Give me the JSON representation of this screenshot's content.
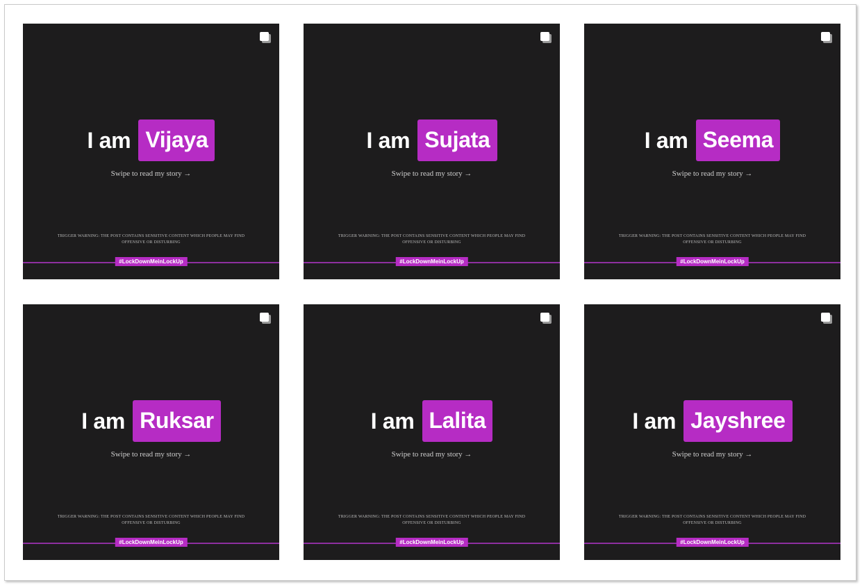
{
  "posts": [
    {
      "iam": "I am",
      "name": "Vijaya",
      "swipe": "Swipe to read my story →",
      "warning": "Trigger warning: The post contains sensitive content which people may find offensive or disturbing",
      "hashtag": "#LockDownMeinLockUp",
      "icon": "carousel-multiple-icon"
    },
    {
      "iam": "I am",
      "name": "Sujata",
      "swipe": "Swipe to read my story →",
      "warning": "Trigger warning: The post contains sensitive content which people may find offensive or disturbing",
      "hashtag": "#LockDownMeinLockUp",
      "icon": "carousel-multiple-icon"
    },
    {
      "iam": "I am",
      "name": "Seema",
      "swipe": "Swipe to read my story →",
      "warning": "Trigger warning: The post contains sensitive content which people may find offensive or disturbing",
      "hashtag": "#LockDownMeinLockUp",
      "icon": "carousel-multiple-icon"
    },
    {
      "iam": "I am",
      "name": "Ruksar",
      "swipe": "Swipe to read my story →",
      "warning": "Trigger warning: The post contains sensitive content which people may find offensive or disturbing",
      "hashtag": "#LockDownMeinLockUp",
      "icon": "carousel-multiple-icon"
    },
    {
      "iam": "I am",
      "name": "Lalita",
      "swipe": "Swipe to read my story →",
      "warning": "Trigger warning: The post contains sensitive content which people may find offensive or disturbing",
      "hashtag": "#LockDownMeinLockUp",
      "icon": "carousel-multiple-icon"
    },
    {
      "iam": "I am",
      "name": "Jayshree",
      "swipe": "Swipe to read my story →",
      "warning": "Trigger warning: The post contains sensitive content which people may find offensive or disturbing",
      "hashtag": "#LockDownMeinLockUp",
      "icon": "carousel-multiple-icon"
    }
  ],
  "colors": {
    "post_background": "#1d1c1d",
    "accent_purple": "#b62cc4",
    "text_white": "#ffffff"
  }
}
